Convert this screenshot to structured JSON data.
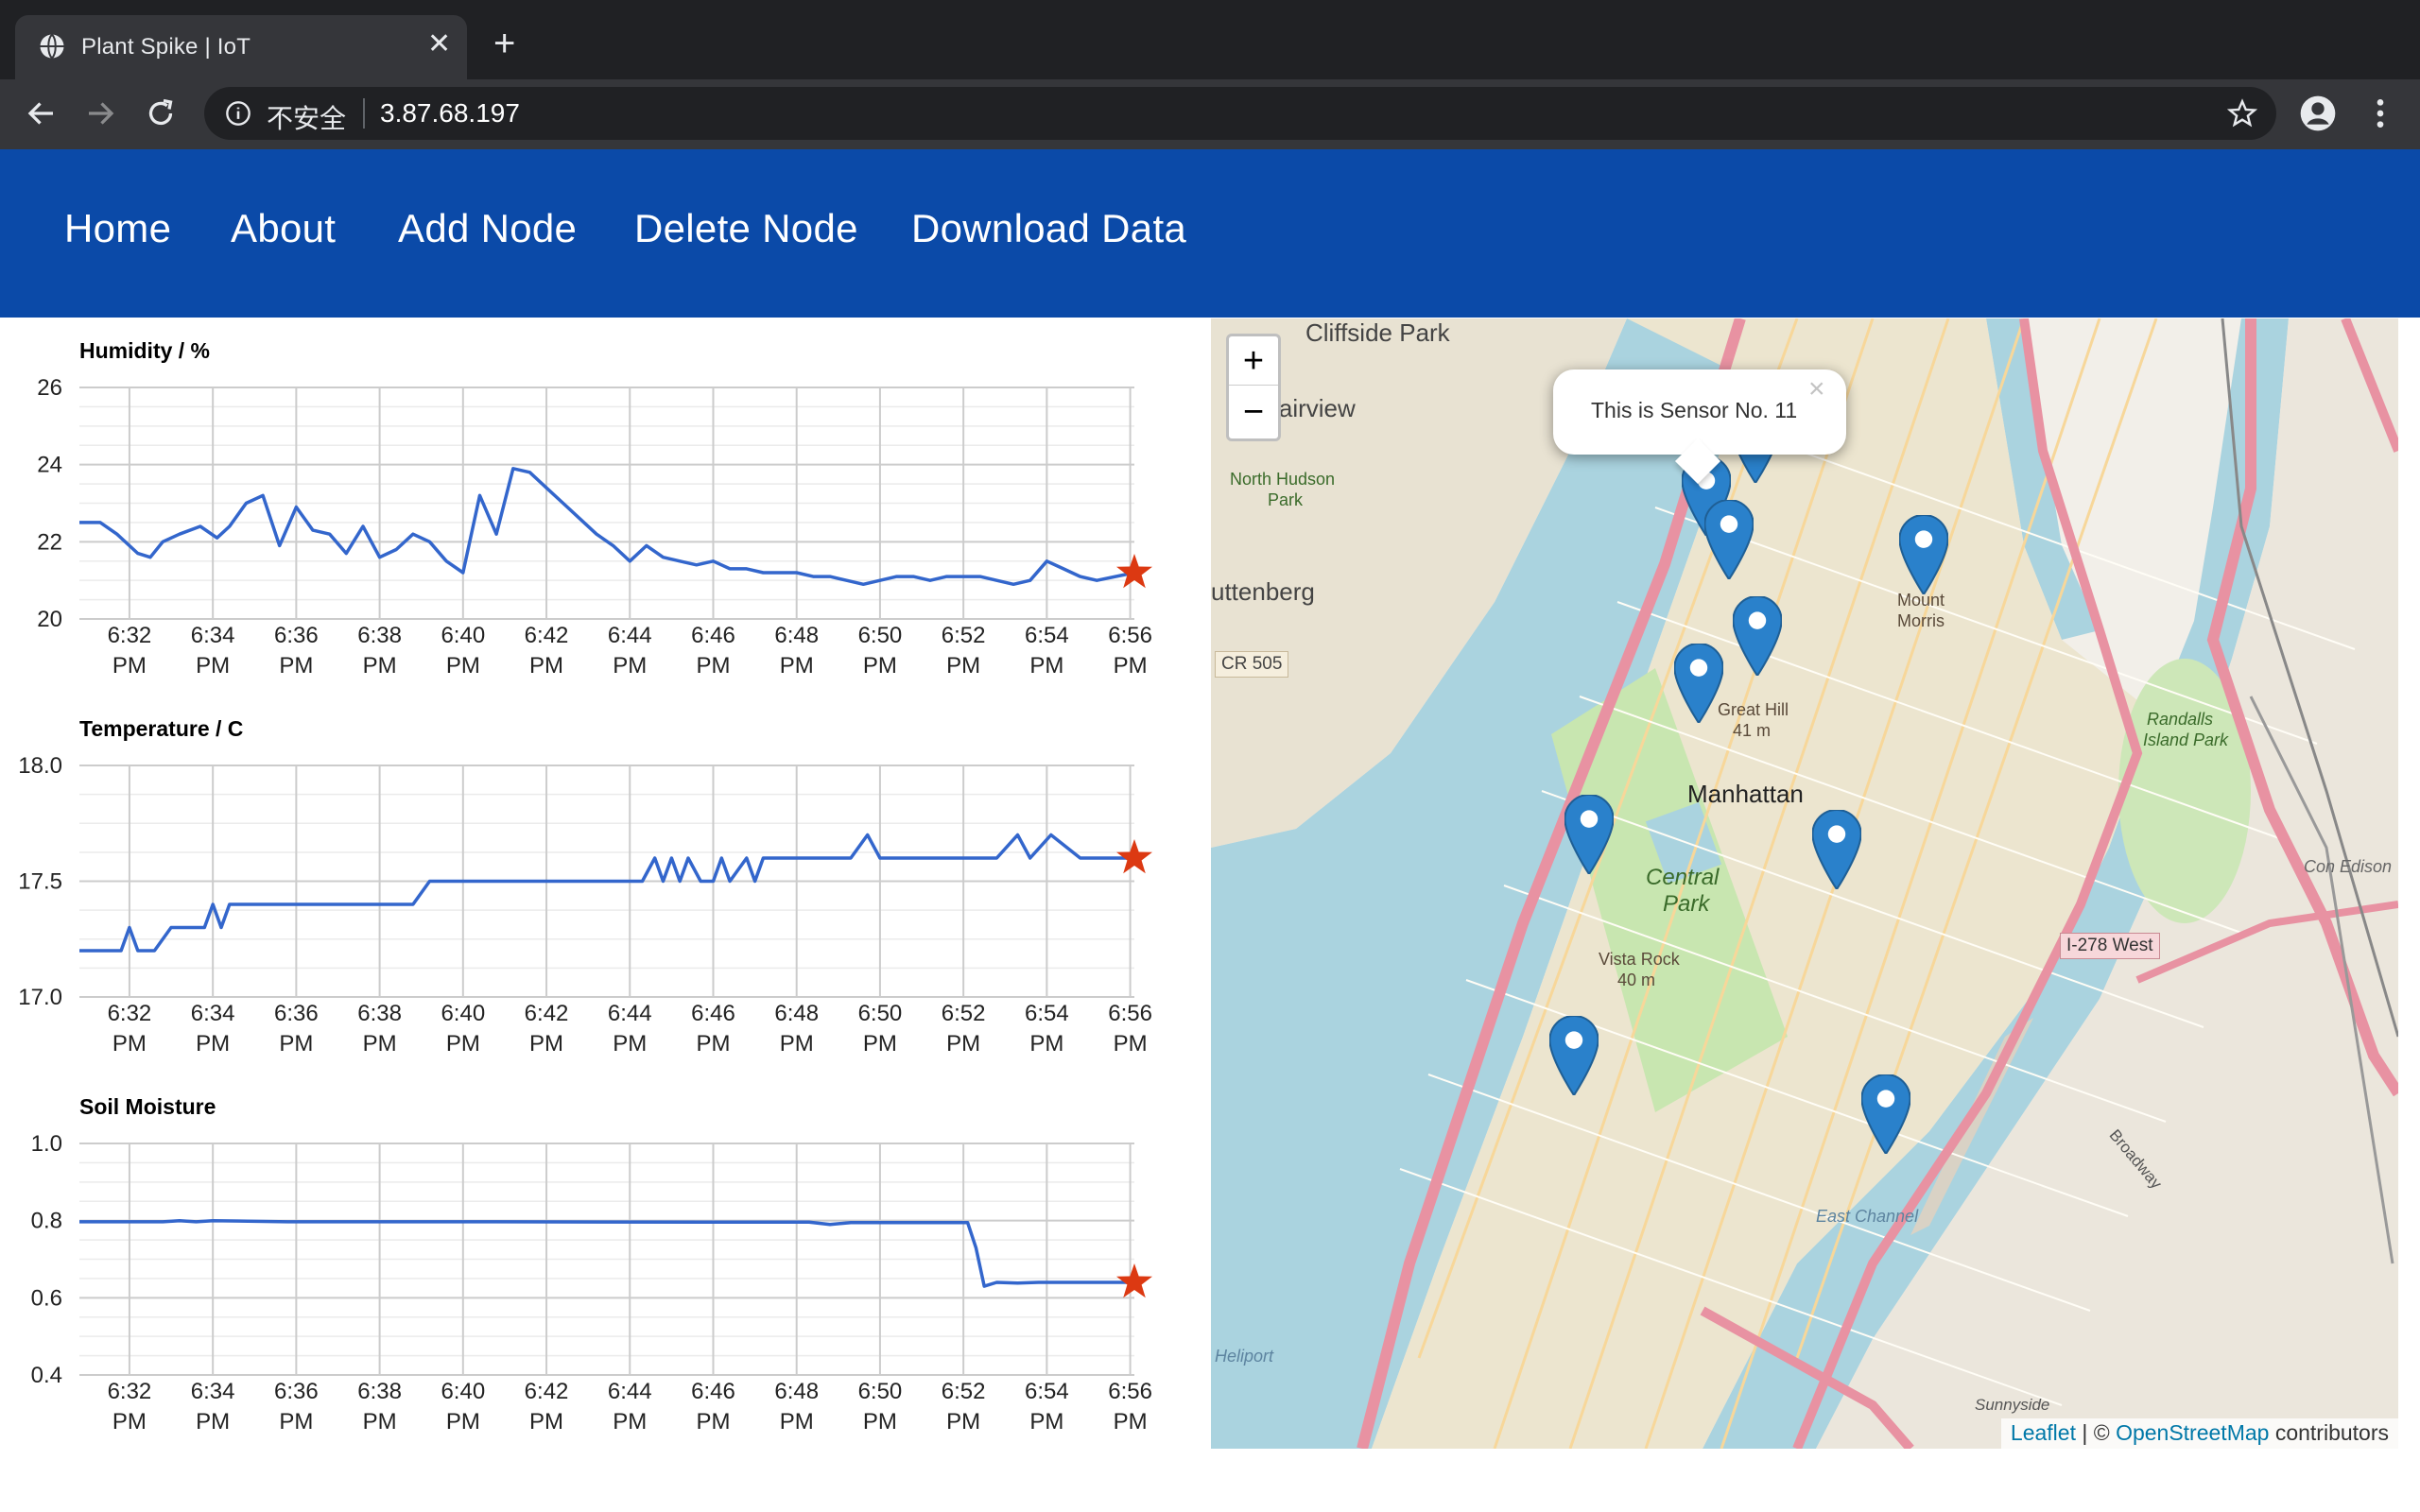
{
  "browser": {
    "tab_title": "Plant Spike | IoT",
    "tab_close": "✕",
    "new_tab": "+",
    "insecure_label": "不安全",
    "url": "3.87.68.197"
  },
  "nav": {
    "items": [
      "Home",
      "About",
      "Add Node",
      "Delete Node",
      "Download Data"
    ]
  },
  "charts": {
    "time_ticks": [
      "6:32",
      "6:34",
      "6:36",
      "6:38",
      "6:40",
      "6:42",
      "6:44",
      "6:46",
      "6:48",
      "6:50",
      "6:52",
      "6:54",
      "6:56"
    ],
    "tick_suffix": "PM"
  },
  "chart_data": [
    {
      "type": "line",
      "title": "Humidity / %",
      "ylim": [
        20,
        26
      ],
      "yticks": [
        "26",
        "24",
        "22",
        "20"
      ],
      "xlim_minutes": [
        0,
        25.3
      ],
      "marker": "star",
      "grid": true,
      "series": [
        {
          "x": [
            0,
            0.5,
            0.9,
            1.4,
            1.7,
            2.0,
            2.4,
            2.9,
            3.3,
            3.6,
            4.0,
            4.4,
            4.8,
            5.2,
            5.6,
            6.0,
            6.4,
            6.8,
            7.2,
            7.6,
            8.0,
            8.4,
            8.8,
            9.2,
            9.6,
            10.0,
            10.4,
            10.8,
            11.2,
            11.6,
            12.0,
            12.4,
            12.8,
            13.2,
            13.6,
            14.0,
            14.4,
            14.8,
            15.2,
            15.6,
            16.0,
            16.4,
            16.8,
            17.2,
            17.6,
            18.0,
            18.4,
            18.8,
            19.2,
            19.6,
            20.0,
            20.4,
            20.8,
            21.2,
            21.6,
            22.0,
            22.4,
            22.8,
            23.2,
            23.6,
            24.0,
            24.4,
            25.3
          ],
          "y": [
            22.5,
            22.5,
            22.2,
            21.7,
            21.6,
            22.0,
            22.2,
            22.4,
            22.1,
            22.4,
            23.0,
            23.2,
            21.9,
            22.9,
            22.3,
            22.2,
            21.7,
            22.4,
            21.6,
            21.8,
            22.2,
            22.0,
            21.5,
            21.2,
            23.2,
            22.2,
            23.9,
            23.8,
            23.4,
            23.0,
            22.6,
            22.2,
            21.9,
            21.5,
            21.9,
            21.6,
            21.5,
            21.4,
            21.5,
            21.3,
            21.3,
            21.2,
            21.2,
            21.2,
            21.1,
            21.1,
            21.0,
            20.9,
            21.0,
            21.1,
            21.1,
            21.0,
            21.1,
            21.1,
            21.1,
            21.0,
            20.9,
            21.0,
            21.5,
            21.3,
            21.1,
            21.0,
            21.2
          ]
        }
      ]
    },
    {
      "type": "line",
      "title": "Temperature / C",
      "ylim": [
        17.0,
        18.0
      ],
      "yticks": [
        "18.0",
        "17.5",
        "17.0"
      ],
      "xlim_minutes": [
        0,
        25.3
      ],
      "marker": "star",
      "grid": true,
      "series": [
        {
          "x": [
            0,
            1.0,
            1.2,
            1.4,
            1.8,
            2.2,
            2.6,
            3.0,
            3.2,
            3.4,
            3.6,
            4.0,
            8.0,
            8.4,
            9.0,
            10.0,
            11.0,
            12.0,
            13.5,
            13.8,
            14.0,
            14.2,
            14.4,
            14.6,
            14.9,
            15.2,
            15.4,
            15.6,
            16.0,
            16.2,
            16.4,
            16.6,
            16.8,
            17.0,
            18.0,
            18.5,
            18.9,
            19.2,
            20.0,
            21.0,
            22.0,
            22.5,
            22.8,
            23.3,
            24.0,
            25.3
          ],
          "y": [
            17.2,
            17.2,
            17.3,
            17.2,
            17.2,
            17.3,
            17.3,
            17.3,
            17.4,
            17.3,
            17.4,
            17.4,
            17.4,
            17.5,
            17.5,
            17.5,
            17.5,
            17.5,
            17.5,
            17.6,
            17.5,
            17.6,
            17.5,
            17.6,
            17.5,
            17.5,
            17.6,
            17.5,
            17.6,
            17.5,
            17.6,
            17.6,
            17.6,
            17.6,
            17.6,
            17.6,
            17.7,
            17.6,
            17.6,
            17.6,
            17.6,
            17.7,
            17.6,
            17.7,
            17.6,
            17.6
          ]
        }
      ]
    },
    {
      "type": "line",
      "title": "Soil Moisture",
      "ylim": [
        0.4,
        1.0
      ],
      "yticks": [
        "1.0",
        "0.8",
        "0.6",
        "0.4"
      ],
      "xlim_minutes": [
        0,
        25.3
      ],
      "marker": "star",
      "grid": true,
      "series": [
        {
          "x": [
            0,
            2.0,
            2.4,
            2.8,
            3.2,
            5.0,
            10.0,
            15.0,
            17.5,
            18.0,
            18.5,
            20.0,
            21.3,
            21.5,
            21.7,
            22.0,
            22.5,
            23.0,
            25.3
          ],
          "y": [
            0.797,
            0.797,
            0.8,
            0.797,
            0.8,
            0.797,
            0.797,
            0.796,
            0.796,
            0.79,
            0.795,
            0.795,
            0.795,
            0.73,
            0.63,
            0.64,
            0.638,
            0.64,
            0.64
          ]
        }
      ]
    }
  ],
  "map": {
    "zoom_in": "+",
    "zoom_out": "−",
    "popup_text": "This is Sensor No. 11",
    "popup_close": "×",
    "attribution_leaflet": "Leaflet",
    "attribution_sep": " | © ",
    "attribution_osm": "OpenStreetMap",
    "attribution_rest": " contributors",
    "labels": {
      "cliffside": "Cliffside Park",
      "fairview": "Fairview",
      "north_hudson": "North Hudson",
      "park": "Park",
      "guttenberg": "uttenberg",
      "cr505": "CR 505",
      "manhattan": "Manhattan",
      "central": "Central",
      "central_park": "Park",
      "great_hill": "Great Hill",
      "great_hill_m": "41 m",
      "vista_rock": "Vista Rock",
      "vista_rock_m": "40 m",
      "mount_morris": "Mount",
      "mount_morris2": "Morris",
      "randalls": "Randalls",
      "island_park": "Island Park",
      "con_edison": "Con Edison",
      "i278": "I-278 West",
      "east_channel": "East Channel",
      "heliport": "Heliport",
      "sunnyside": "Sunnyside",
      "broadway": "Broadway"
    },
    "pin_color": "#2a81cb"
  }
}
